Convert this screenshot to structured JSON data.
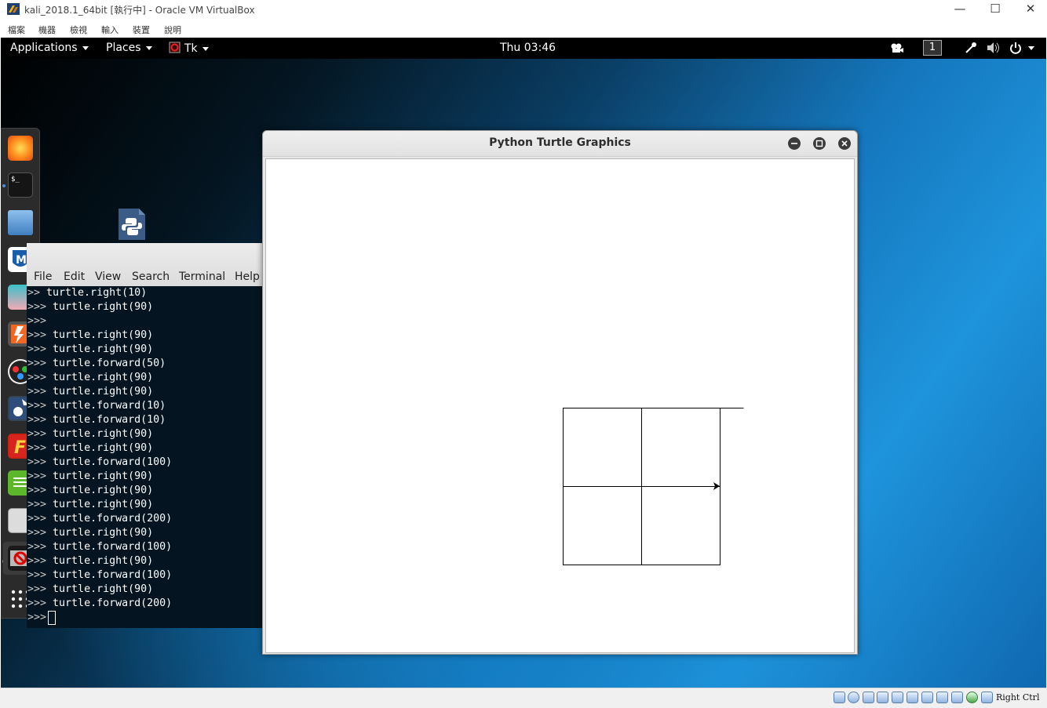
{
  "host": {
    "window_title": "kali_2018.1_64bit [執行中] - Oracle VM VirtualBox",
    "menu": [
      "檔案",
      "機器",
      "檢視",
      "輸入",
      "裝置",
      "說明"
    ],
    "host_key": "Right Ctrl"
  },
  "gnome": {
    "applications": "Applications",
    "places": "Places",
    "app_name": "Tk",
    "clock": "Thu 03:46",
    "workspace": "1"
  },
  "dock": {
    "items": [
      "firefox-icon",
      "terminal-icon",
      "files-icon",
      "metasploit-icon",
      "armitage-icon",
      "burpsuite-icon",
      "maltego-icon",
      "beef-icon",
      "faraday-icon",
      "leafpad-icon",
      "cherrytree-icon",
      "tk-app-icon",
      "show-apps-icon"
    ]
  },
  "terminal": {
    "menu": [
      "File",
      "Edit",
      "View",
      "Search",
      "Terminal",
      "Help"
    ],
    "lines": [
      {
        "prompt": ">>",
        "cmd": " turtle.right(10)"
      },
      {
        "prompt": ">>>",
        "cmd": " turtle.right(90)"
      },
      {
        "prompt": ">>>",
        "cmd": ""
      },
      {
        "prompt": ">>>",
        "cmd": " turtle.right(90)"
      },
      {
        "prompt": ">>>",
        "cmd": " turtle.right(90)"
      },
      {
        "prompt": ">>>",
        "cmd": " turtle.forward(50)"
      },
      {
        "prompt": ">>>",
        "cmd": " turtle.right(90)"
      },
      {
        "prompt": ">>>",
        "cmd": " turtle.right(90)"
      },
      {
        "prompt": ">>>",
        "cmd": " turtle.forward(10)"
      },
      {
        "prompt": ">>>",
        "cmd": " turtle.forward(10)"
      },
      {
        "prompt": ">>>",
        "cmd": " turtle.right(90)"
      },
      {
        "prompt": ">>>",
        "cmd": " turtle.right(90)"
      },
      {
        "prompt": ">>>",
        "cmd": " turtle.forward(100)"
      },
      {
        "prompt": ">>>",
        "cmd": " turtle.right(90)"
      },
      {
        "prompt": ">>>",
        "cmd": " turtle.right(90)"
      },
      {
        "prompt": ">>>",
        "cmd": " turtle.right(90)"
      },
      {
        "prompt": ">>>",
        "cmd": " turtle.forward(200)"
      },
      {
        "prompt": ">>>",
        "cmd": " turtle.right(90)"
      },
      {
        "prompt": ">>>",
        "cmd": " turtle.forward(100)"
      },
      {
        "prompt": ">>>",
        "cmd": " turtle.right(90)"
      },
      {
        "prompt": ">>>",
        "cmd": " turtle.forward(100)"
      },
      {
        "prompt": ">>>",
        "cmd": " turtle.right(90)"
      },
      {
        "prompt": ">>>",
        "cmd": " turtle.forward(200)"
      }
    ],
    "current_prompt": ">>>"
  },
  "turtle_window": {
    "title": "Python Turtle Graphics"
  }
}
